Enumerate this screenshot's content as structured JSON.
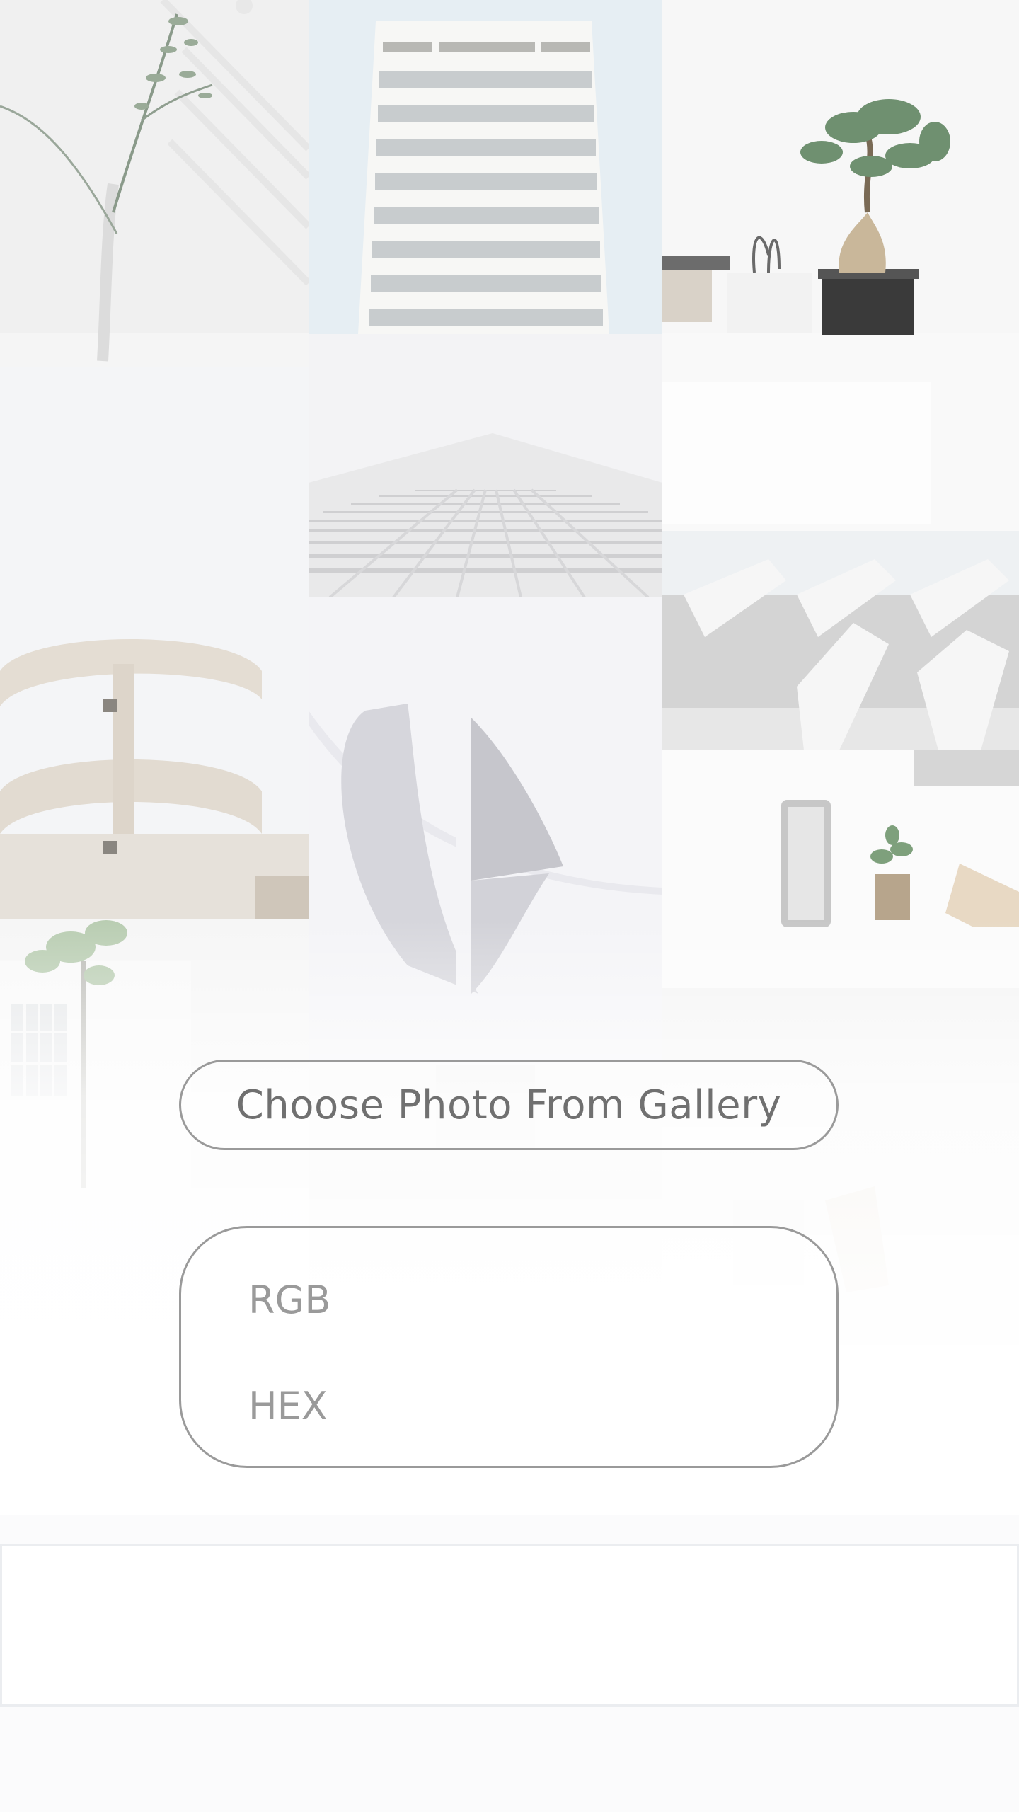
{
  "actions": {
    "choose_photo_label": "Choose Photo From Gallery"
  },
  "color_readout": {
    "rgb_label": "RGB",
    "rgb_value": "",
    "hex_label": "HEX",
    "hex_value": ""
  },
  "gallery": {
    "tiles": [
      "vase",
      "tower",
      "bonsai",
      "grid-facade",
      "fins",
      "spiral-balconies",
      "arch",
      "speaker",
      "tree-house",
      "lower-mid",
      "lower-right"
    ]
  },
  "colors": {
    "button_border": "#9a9a9a",
    "button_text": "#707070",
    "label_text": "#9a9a9a",
    "panel_border": "#ebedf0",
    "background": "#ffffff"
  }
}
